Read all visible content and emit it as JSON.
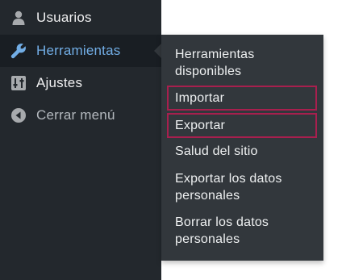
{
  "sidebar": {
    "items": [
      {
        "label": "Usuarios",
        "icon": "user-icon"
      },
      {
        "label": "Herramientas",
        "icon": "wrench-icon",
        "active": true
      },
      {
        "label": "Ajustes",
        "icon": "settings-sliders-icon"
      },
      {
        "label": "Cerrar menú",
        "icon": "collapse-arrow-icon"
      }
    ]
  },
  "submenu": {
    "items": [
      {
        "label": "Herramientas disponibles"
      },
      {
        "label": "Importar",
        "highlighted": true
      },
      {
        "label": "Exportar",
        "highlighted": true
      },
      {
        "label": "Salud del sitio"
      },
      {
        "label": "Exportar los datos personales"
      },
      {
        "label": "Borrar los datos personales"
      }
    ]
  },
  "colors": {
    "sidebar_bg": "#23282d",
    "active_bg": "#191e23",
    "active_text": "#72aee6",
    "submenu_bg": "#32373c",
    "highlight_border": "#a81f4e",
    "text": "#f0f0f1"
  }
}
